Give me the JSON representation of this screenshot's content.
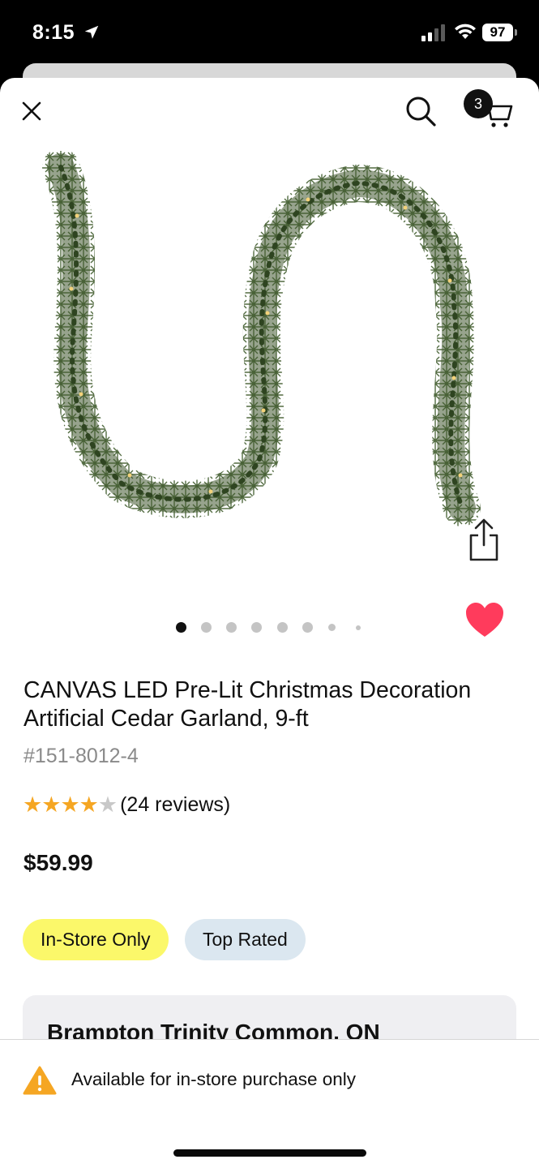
{
  "status_bar": {
    "time": "8:15",
    "battery": "97"
  },
  "header": {
    "cart_count": "3"
  },
  "gallery": {
    "image_count": 8,
    "active_index": 0
  },
  "product": {
    "title": "CANVAS LED Pre-Lit Christmas Decoration Artificial Cedar Garland, 9-ft",
    "sku": "#151-8012-4",
    "rating": 4,
    "rating_max": 5,
    "reviews": "(24 reviews)",
    "price": "$59.99",
    "favorited": true
  },
  "badges": {
    "in_store": "In-Store Only",
    "top_rated": "Top Rated"
  },
  "store": {
    "name": "Brampton Trinity Common, ON"
  },
  "availability": {
    "message": "Available for in-store purchase only"
  },
  "colors": {
    "star": "#f5a623",
    "heart": "#ff3b5c",
    "in_store_badge": "#fbf86a",
    "top_rated_badge": "#dbe7f0",
    "warning": "#f5a623"
  }
}
